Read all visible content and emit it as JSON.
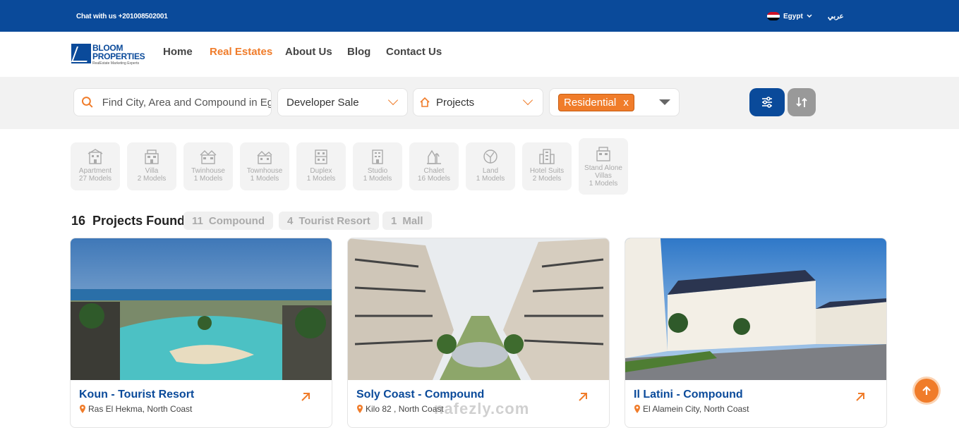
{
  "topbar": {
    "chat": "Chat with us  +201008502001",
    "country": "Egypt",
    "lang": "عربي"
  },
  "logo": {
    "name_line1": "BLOOM",
    "name_line2": "PROPERTIES",
    "tagline": "RealEstate Marketing Experts"
  },
  "nav": {
    "items": [
      "Home",
      "Real Estates",
      "About Us",
      "Blog",
      "Contact Us"
    ],
    "active": "Real Estates"
  },
  "search": {
    "placeholder": "Find City, Area and Compound in Eg",
    "sale_type": "Developer Sale",
    "category": "Projects",
    "selected_tag": "Residential",
    "remove_tag": "x"
  },
  "types": [
    {
      "label": "Apartment",
      "count": "27 Models",
      "icon": "apartment-icon"
    },
    {
      "label": "Villa",
      "count": "2 Models",
      "icon": "villa-icon"
    },
    {
      "label": "Twinhouse",
      "count": "1 Models",
      "icon": "twinhouse-icon"
    },
    {
      "label": "Townhouse",
      "count": "1 Models",
      "icon": "townhouse-icon"
    },
    {
      "label": "Duplex",
      "count": "1 Models",
      "icon": "duplex-icon"
    },
    {
      "label": "Studio",
      "count": "1 Models",
      "icon": "studio-icon"
    },
    {
      "label": "Chalet",
      "count": "16 Models",
      "icon": "chalet-icon"
    },
    {
      "label": "Land",
      "count": "1 Models",
      "icon": "land-icon"
    },
    {
      "label": "Hotel Suits",
      "count": "2 Models",
      "icon": "hotel-icon"
    },
    {
      "label": "Stand Alone Villas",
      "count": "1 Models",
      "icon": "standalone-villa-icon"
    }
  ],
  "results": {
    "count": "16",
    "label": "Projects Found",
    "chips": [
      {
        "count": "11",
        "label": "Compound"
      },
      {
        "count": "4",
        "label": "Tourist Resort"
      },
      {
        "count": "1",
        "label": "Mall"
      }
    ]
  },
  "cards": [
    {
      "title": "Koun - Tourist Resort",
      "location": "Ras El Hekma, North Coast"
    },
    {
      "title": "Soly Coast - Compound",
      "location": "Kilo 82 , North Coast"
    },
    {
      "title": "Il Latini - Compound",
      "location": "El Alamein City, North Coast"
    }
  ],
  "watermark": "nafezly.com",
  "colors": {
    "brand_blue": "#0a4a9a",
    "accent_orange": "#f07c2a"
  }
}
